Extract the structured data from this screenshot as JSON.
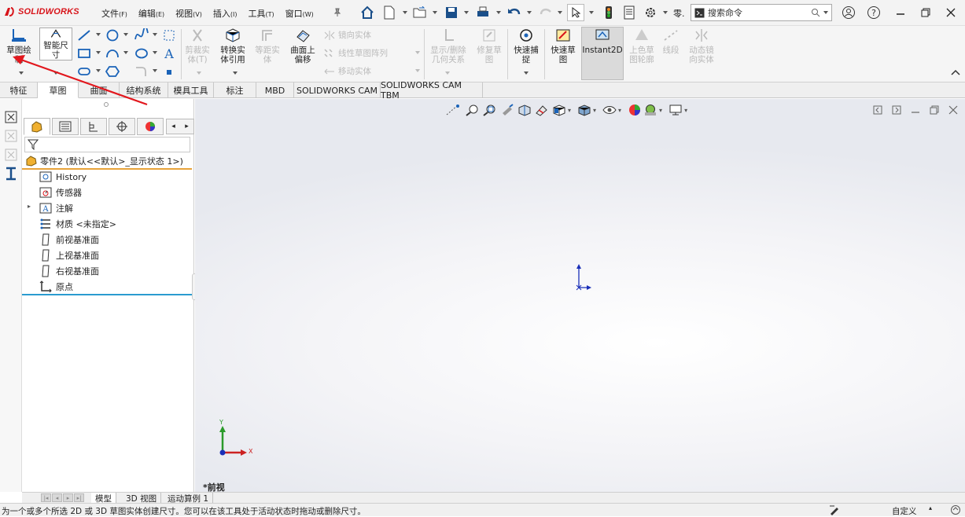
{
  "app": {
    "brand": "SOLIDWORKS"
  },
  "menu": [
    {
      "label": "文件",
      "key": "(F)"
    },
    {
      "label": "编辑",
      "key": "(E)"
    },
    {
      "label": "视图",
      "key": "(V)"
    },
    {
      "label": "插入",
      "key": "(I)"
    },
    {
      "label": "工具",
      "key": "(T)"
    },
    {
      "label": "窗口",
      "key": "(W)"
    }
  ],
  "toolbar": {
    "overflow_label": "零.",
    "search_placeholder": "搜索命令"
  },
  "ribbon": {
    "sketch": "草图绘\n制",
    "smart_dim": "智能尺\n寸",
    "trim": "剪裁实\n体(T)",
    "convert": "转换实\n体引用",
    "offset": "等距实\n体",
    "offset_surface": "曲面上\n偏移",
    "mirror": "镜向实体",
    "linear_pattern": "线性草图阵列",
    "move": "移动实体",
    "relations": "显示/删除\n几何关系",
    "repair": "修复草\n图",
    "quick_snap": "快速捕\n捉",
    "rapid_sketch": "快速草\n图",
    "instant2d": "Instant2D",
    "shaded": "上色草\n图轮廓",
    "segment": "线段",
    "dynamic_mirror": "动态镜\n向实体"
  },
  "tabs": [
    "特征",
    "草图",
    "曲面",
    "结构系统",
    "模具工具",
    "标注",
    "MBD",
    "SOLIDWORKS CAM",
    "SOLIDWORKS CAM TBM"
  ],
  "active_tab": "草图",
  "tree": {
    "root": "零件2 (默认<<默认>_显示状态 1>)",
    "items": [
      "History",
      "传感器",
      "注解",
      "材质 <未指定>",
      "前视基准面",
      "上视基准面",
      "右视基准面",
      "原点"
    ]
  },
  "viewport": {
    "view_label": "*前视",
    "axis_y": "Y",
    "axis_x": "X"
  },
  "bottom_tabs": [
    "模型",
    "3D 视图",
    "运动算例 1"
  ],
  "status": {
    "message": "为一个或多个所选 2D 或 3D 草图实体创建尺寸。您可以在该工具处于活动状态时拖动或删除尺寸。",
    "custom": "自定义"
  },
  "colors": {
    "brand_red": "#d8141a",
    "accent_blue": "#1a63b8",
    "arrow_red": "#e2171d"
  }
}
